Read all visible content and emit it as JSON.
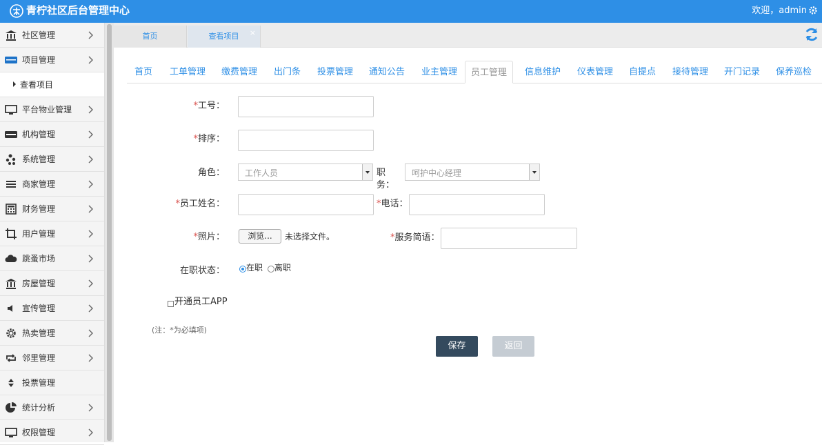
{
  "header": {
    "title": "青柠社区后台管理中心",
    "welcome": "欢迎，admin",
    "logo_icon": "leaf-logo-icon",
    "settings_icon": "gear-icon"
  },
  "sidebar": {
    "items": [
      {
        "label": "社区管理",
        "icon": "bank-icon"
      },
      {
        "label": "项目管理",
        "icon": "card-icon"
      },
      {
        "label": "查看项目",
        "sub": true
      },
      {
        "label": "平台物业管理",
        "icon": "monitor-icon"
      },
      {
        "label": "机构管理",
        "icon": "stripe-icon"
      },
      {
        "label": "系统管理",
        "icon": "yelp-icon"
      },
      {
        "label": "商家管理",
        "icon": "menu-icon"
      },
      {
        "label": "财务管理",
        "icon": "calculator-icon"
      },
      {
        "label": "用户管理",
        "icon": "crop-icon"
      },
      {
        "label": "跳蚤市场",
        "icon": "cloud-icon"
      },
      {
        "label": "房屋管理",
        "icon": "bank-icon"
      },
      {
        "label": "宣传管理",
        "icon": "volume-icon"
      },
      {
        "label": "热卖管理",
        "icon": "settings-icon"
      },
      {
        "label": "邻里管理",
        "icon": "retweet-icon"
      },
      {
        "label": "投票管理",
        "icon": "sort-icon"
      },
      {
        "label": "统计分析",
        "icon": "pie-chart-icon"
      },
      {
        "label": "权限管理",
        "icon": "monitor-icon"
      }
    ]
  },
  "tabs": [
    {
      "label": "首页"
    },
    {
      "label": "查看项目",
      "close": "×"
    }
  ],
  "nav": [
    "首页",
    "工单管理",
    "缴费管理",
    "出门条",
    "投票管理",
    "通知公告",
    "业主管理",
    "员工管理",
    "信息维护",
    "仪表管理",
    "自提点",
    "接待管理",
    "开门记录",
    "保养巡检"
  ],
  "form": {
    "required_mark": "*",
    "job_no_label": "工号：",
    "sort_label": "排序：",
    "role_label": "角色：",
    "role_value": "工作人员",
    "position_label": "职务：",
    "position_value": "呵护中心经理",
    "name_label": "员工姓名：",
    "phone_label": "电话：",
    "photo_label": "照片：",
    "browse_label": "浏览...",
    "no_file_label": "未选择文件。",
    "service_label": "服务简语：",
    "status_label": "在职状态：",
    "status_on": "在职",
    "status_off": "离职",
    "app_label": "开通员工APP",
    "note": "(注：*为必填项)",
    "save_label": "保存",
    "back_label": "返回"
  },
  "colors": {
    "primary": "#2e8fe6",
    "save": "#344a5e",
    "back": "#c5ccd3"
  }
}
